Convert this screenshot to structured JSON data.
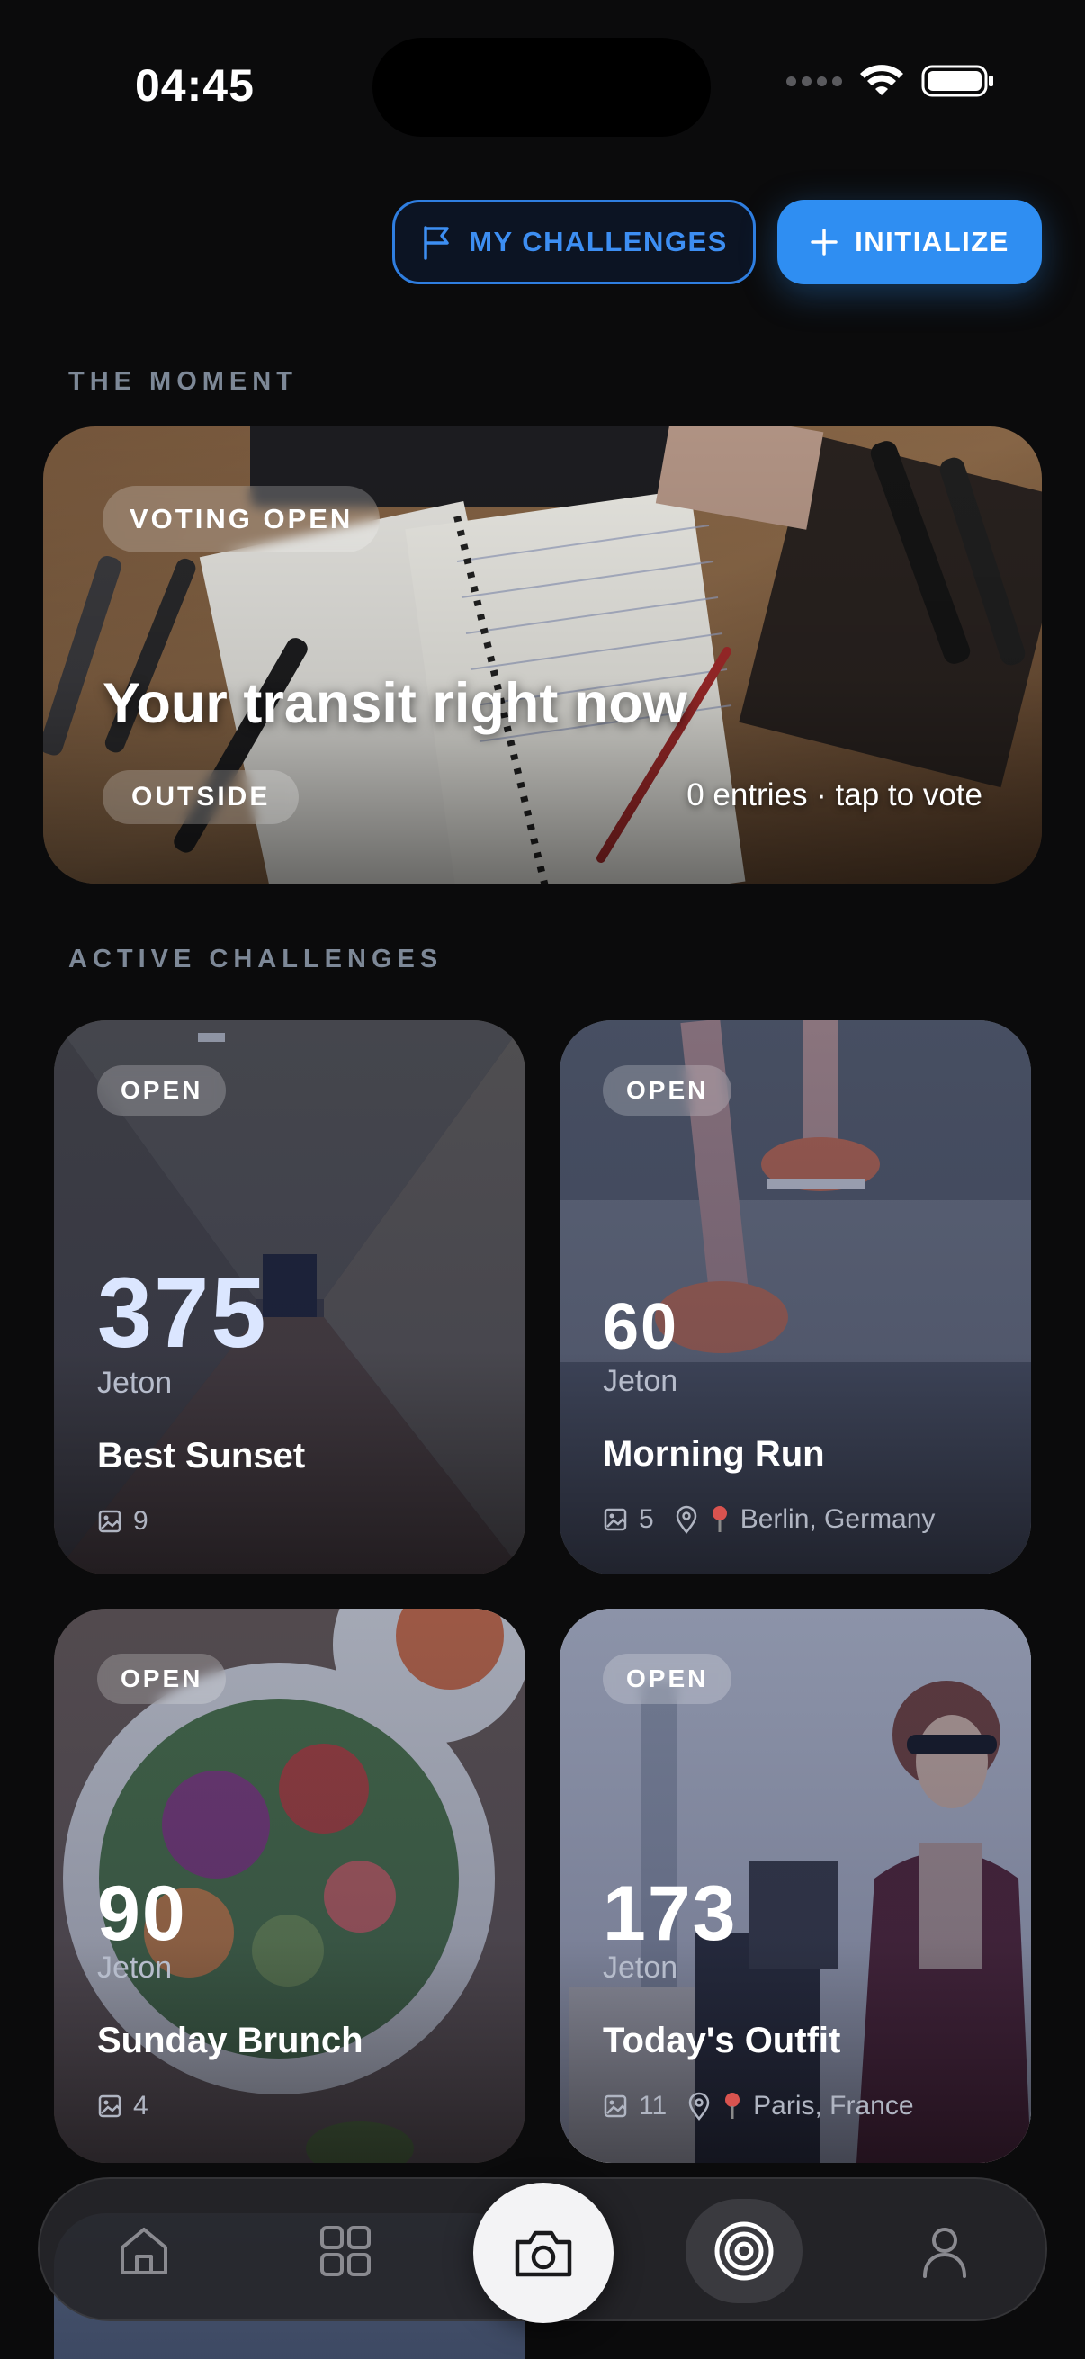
{
  "status_bar": {
    "time": "04:45"
  },
  "header": {
    "my_challenges_label": "MY CHALLENGES",
    "initialize_label": "INITIALIZE"
  },
  "moment": {
    "section_label": "THE MOMENT",
    "badge": "VOTING OPEN",
    "title": "Your transit right now",
    "tag": "OUTSIDE",
    "meta": "0 entries · tap to vote"
  },
  "active": {
    "section_label": "ACTIVE CHALLENGES",
    "cards": [
      {
        "status": "OPEN",
        "points": "375",
        "unit": "Jeton",
        "title": "Best Sunset",
        "photos": "9",
        "location": ""
      },
      {
        "status": "OPEN",
        "points": "60",
        "unit": "Jeton",
        "title": "Morning Run",
        "photos": "5",
        "location": "Berlin, Germany"
      },
      {
        "status": "OPEN",
        "points": "90",
        "unit": "Jeton",
        "title": "Sunday Brunch",
        "photos": "4",
        "location": ""
      },
      {
        "status": "OPEN",
        "points": "173",
        "unit": "Jeton",
        "title": "Today's Outfit",
        "photos": "11",
        "location": "Paris, France"
      }
    ]
  },
  "nav": {
    "items": [
      "home-icon",
      "grid-icon",
      "camera-icon",
      "target-icon",
      "profile-icon"
    ],
    "active": "target-icon"
  },
  "colors": {
    "accent": "#2f8ef2",
    "background": "#0b0b0c"
  }
}
